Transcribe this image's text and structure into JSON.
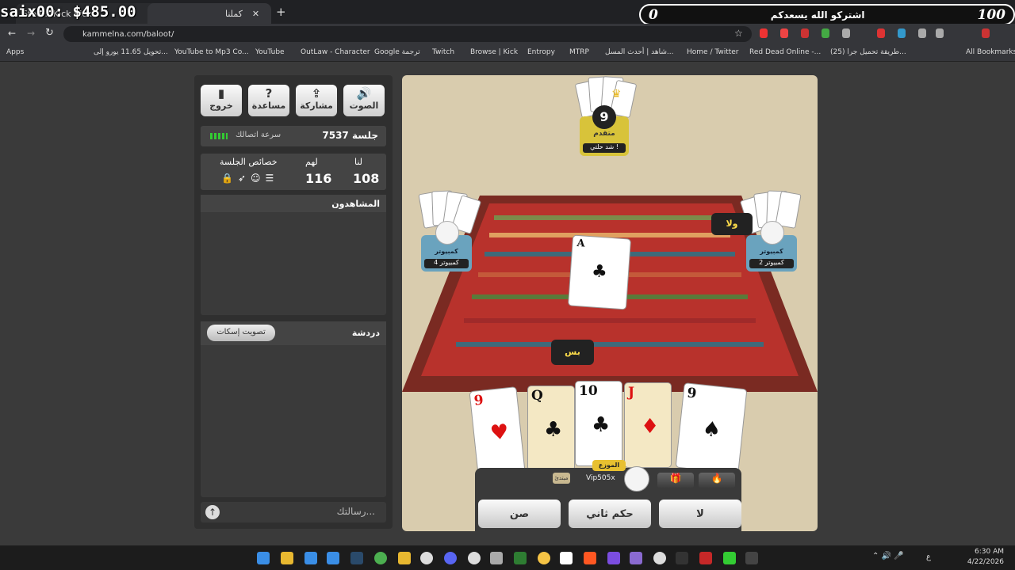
{
  "overlay": {
    "left_text": "saix00: $485.00",
    "right_text": "اشتركو الله يسعدكم",
    "right_num": "100",
    "left_num": "0"
  },
  "browser": {
    "tabs": [
      {
        "label": "Stee... Kick Kick"
      },
      {
        "label": "كملنا"
      }
    ],
    "url": "kammelna.com/baloot/",
    "bookmarks": [
      "Apps",
      "تحويل 11.65 يورو إلى...",
      "YouTube to Mp3 Co...",
      "YouTube",
      "OutLaw - Character",
      "Google ترجمة",
      "Twitch",
      "Browse | Kick",
      "Entropy",
      "MTRP",
      "شاهد | أحدث المسل...",
      "Home / Twitter",
      "Red Dead Online -...",
      "(25) طريقة تحميل جرا...",
      "All Bookmarks"
    ]
  },
  "panel": {
    "buttons": [
      {
        "label": "خروج",
        "icon": "exit-icon"
      },
      {
        "label": "مساعدة",
        "icon": "help-icon"
      },
      {
        "label": "مشاركة",
        "icon": "share-icon"
      },
      {
        "label": "الصوت",
        "icon": "sound-icon"
      }
    ],
    "session_label": "جلسة 7537",
    "connection_label": "سرعة اتصالك",
    "score_headers": {
      "props": "خصائص الجلسة",
      "them": "لهم",
      "us": "لنا"
    },
    "score_values": {
      "them": "116",
      "us": "108"
    },
    "viewers_title": "المشاهدون",
    "chat_title": "دردشة",
    "mute_vote": "تصويت إسكات",
    "chat_placeholder": "رسالتك..."
  },
  "game": {
    "top_player": {
      "count": "9",
      "rank": "متقدم",
      "name": "شد حلتي !"
    },
    "left_player": {
      "rank": "كمبيوتر",
      "name": "كمبيوتر 4"
    },
    "right_player": {
      "rank": "كمبيوتر",
      "name": "كمبيوتر 2",
      "bubble": "ولا"
    },
    "center_card": {
      "rank": "A",
      "suit": "♣"
    },
    "pass_bubble": "بس",
    "hand": [
      {
        "rank": "9",
        "suit": "♥",
        "color": "red"
      },
      {
        "rank": "Q",
        "suit": "♣",
        "color": "blk"
      },
      {
        "rank": "10",
        "suit": "♣",
        "color": "blk"
      },
      {
        "rank": "J",
        "suit": "♦",
        "color": "red"
      },
      {
        "rank": "9",
        "suit": "♠",
        "color": "blk"
      }
    ],
    "dealer_label": "الموزع",
    "me_name": "Vip505x",
    "me_rank": "مبتدئ",
    "actions": {
      "sun": "صن",
      "second": "حكم ثاني",
      "pass": "لا"
    }
  },
  "taskbar": {
    "time": "6:30 AM",
    "date": "4/22/2026",
    "lang": "ع"
  },
  "colors": {
    "panel": "#2f2f2f",
    "felt": "#d9ccae",
    "carpet_red": "#b8322c",
    "accent_green": "#3c3"
  }
}
